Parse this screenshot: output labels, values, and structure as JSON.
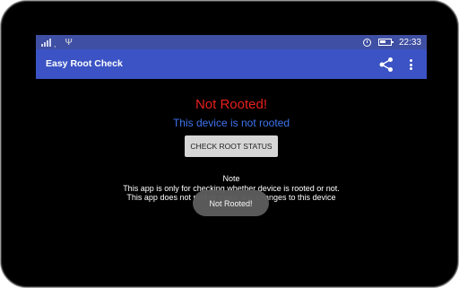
{
  "statusbar": {
    "time": "22:33",
    "icons": [
      "signal-icon",
      "usb-icon",
      "alarm-icon",
      "battery-icon"
    ]
  },
  "appbar": {
    "title": "Easy Root Check",
    "icons": [
      "share-icon",
      "overflow-menu-icon"
    ],
    "color": "#3b53c4"
  },
  "main": {
    "status_title": "Not Rooted!",
    "status_subtitle": "This device is not rooted",
    "check_button_label": "CHECK ROOT STATUS",
    "note_heading": "Note",
    "note_line1": "This app is only for checking whether device is rooted or not.",
    "note_line2": "This app does not root or make any changes to this device"
  },
  "toast": {
    "message": "Not Rooted!"
  },
  "colors": {
    "status_title": "#e8201c",
    "status_subtitle": "#3e74ef",
    "statusbar": "#3f4fa3"
  }
}
